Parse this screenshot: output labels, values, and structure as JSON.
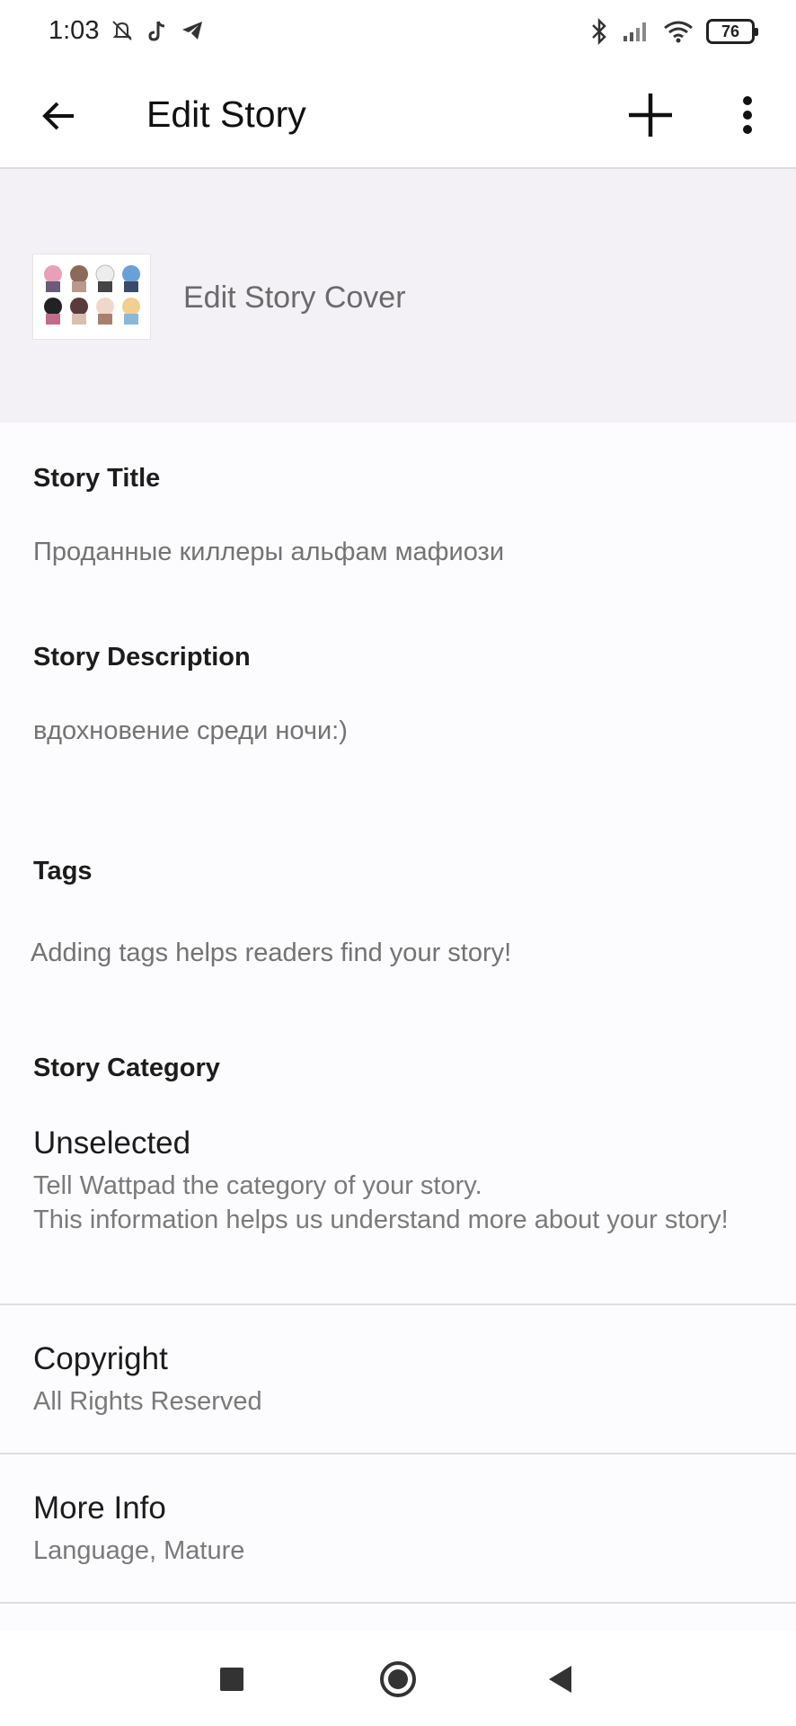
{
  "status": {
    "time": "1:03",
    "battery": "76"
  },
  "header": {
    "title": "Edit Story"
  },
  "cover": {
    "label": "Edit Story Cover"
  },
  "fields": {
    "title_label": "Story Title",
    "title_value": "Проданные киллеры альфам мафиози",
    "description_label": "Story Description",
    "description_value": "вдохновение среди ночи:)",
    "tags_label": "Tags",
    "tags_placeholder": "Adding tags helps readers find your story!",
    "category_label": "Story Category"
  },
  "rows": {
    "category_value": "Unselected",
    "category_hint_line1": "Tell Wattpad the category of your story.",
    "category_hint_line2": "This information helps us understand more about your story!",
    "copyright_title": "Copyright",
    "copyright_value": "All Rights Reserved",
    "more_info_title": "More Info",
    "more_info_value": "Language, Mature"
  },
  "icons": {
    "back": "arrow-left-icon",
    "add": "plus-icon",
    "more": "more-vertical-icon",
    "nav_recents": "square-icon",
    "nav_home": "circle-icon",
    "nav_back": "triangle-back-icon"
  }
}
